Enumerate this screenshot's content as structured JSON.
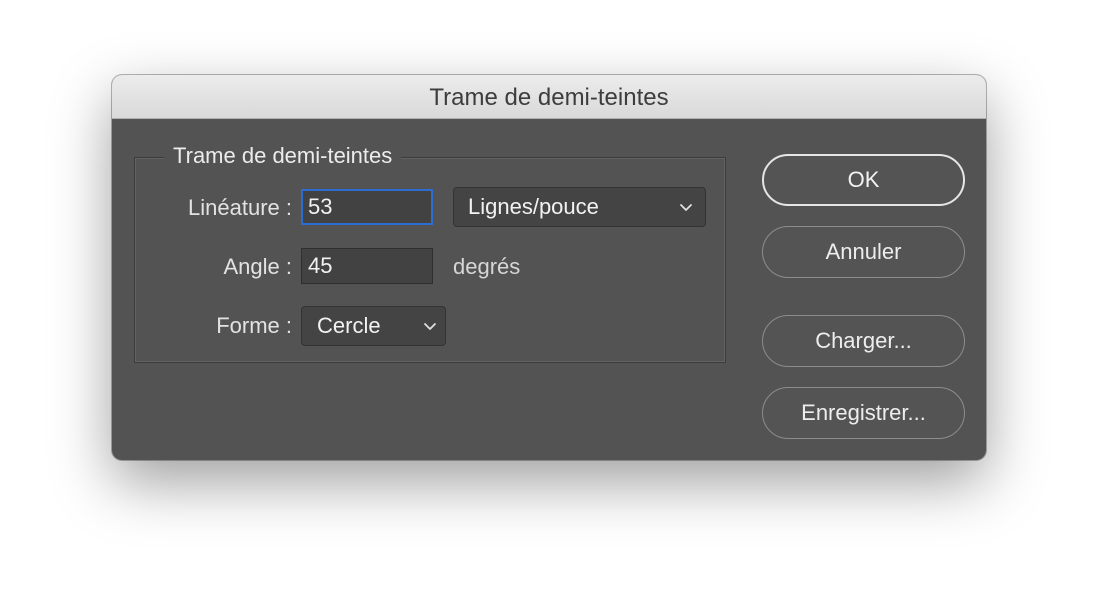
{
  "window": {
    "title": "Trame de demi-teintes"
  },
  "group": {
    "legend": "Trame de demi-teintes"
  },
  "fields": {
    "lineature": {
      "label": "Linéature :",
      "value": "53",
      "unit_selected": "Lignes/pouce"
    },
    "angle": {
      "label": "Angle :",
      "value": "45",
      "unit": "degrés"
    },
    "forme": {
      "label": "Forme :",
      "selected": "Cercle"
    }
  },
  "buttons": {
    "ok": "OK",
    "cancel": "Annuler",
    "load": "Charger...",
    "save": "Enregistrer..."
  },
  "icons": {
    "dropdown": "chevron-down-icon"
  },
  "colors": {
    "dialog_bg": "#535353",
    "focus_ring": "#2e6cd1"
  }
}
